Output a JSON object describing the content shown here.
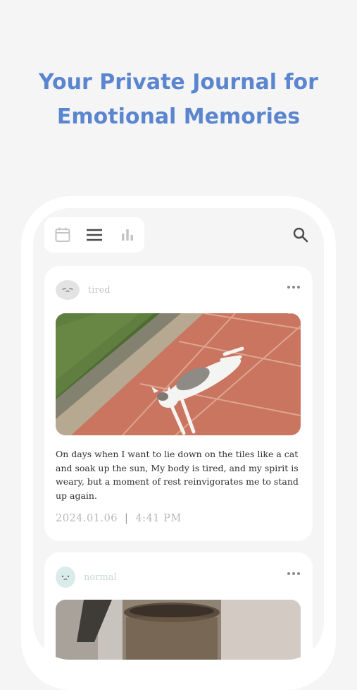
{
  "headline": {
    "line1": "Your Private Journal for",
    "line2": "Emotional Memories"
  },
  "toolbar": {
    "tabs": [
      {
        "icon": "calendar-icon",
        "active": false
      },
      {
        "icon": "list-icon",
        "active": true
      },
      {
        "icon": "bar-chart-icon",
        "active": false
      }
    ],
    "search_icon": "search-icon"
  },
  "entries": [
    {
      "mood": "tired",
      "mood_color": "#e3e3e3",
      "photo": "cat lying on red tiles",
      "text": "On days when I want to lie down on the tiles like a cat and soak up the sun, My body is tired, and my spirit is weary, but a moment of rest reinvigorates me to stand up again.",
      "date": "2024.01.06",
      "time": "4:41 PM"
    },
    {
      "mood": "normal",
      "mood_color": "#d9ece9",
      "photo": "iced coffee glass"
    }
  ],
  "colors": {
    "accent": "#5b86cf",
    "background": "#f5f5f6",
    "card": "#ffffff"
  }
}
